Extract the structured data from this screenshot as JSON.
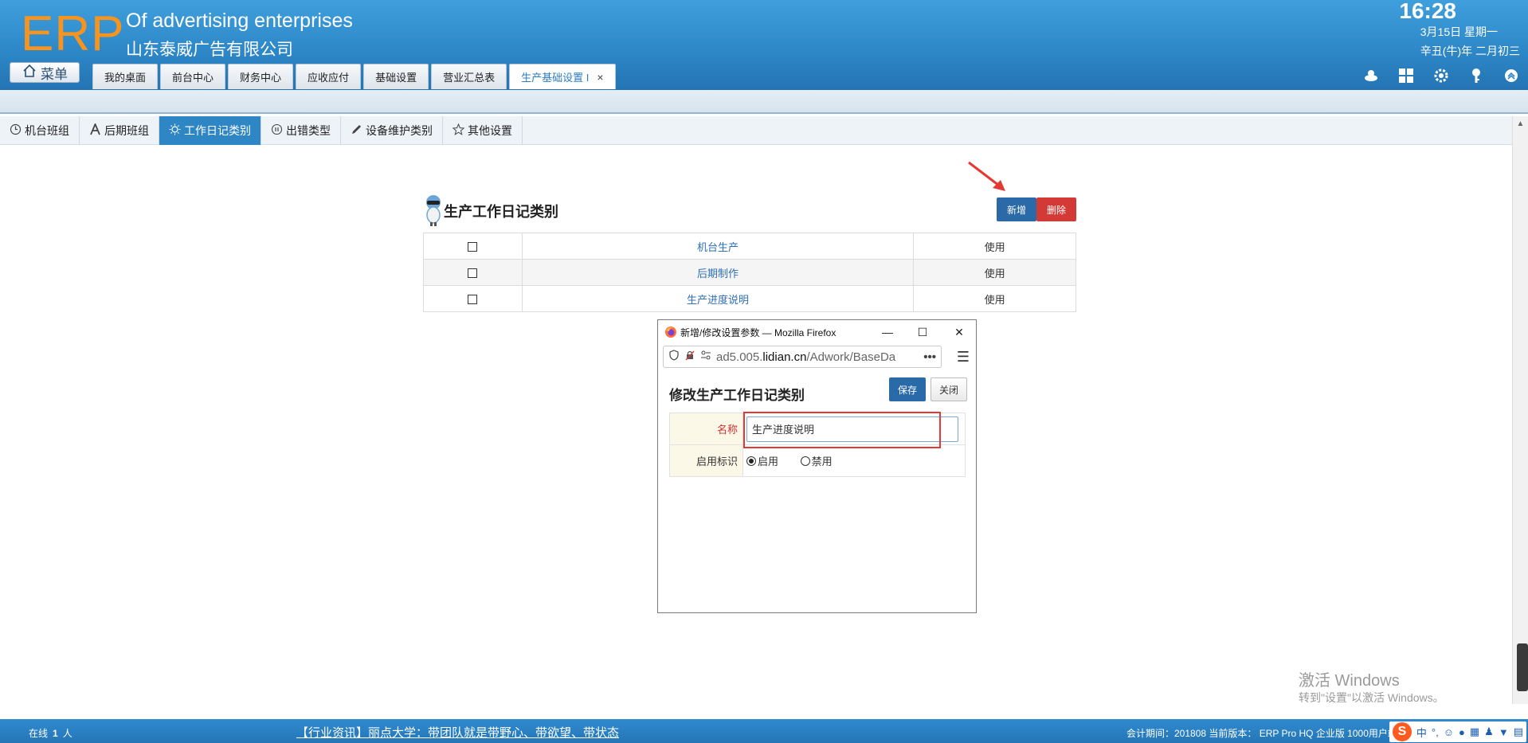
{
  "header": {
    "logo": "ERP",
    "company_en": "Of advertising enterprises",
    "company_cn": "山东泰威广告有限公司",
    "time": "16:28",
    "date": "3月15日 星期一",
    "lunar": "辛丑(牛)年 二月初三",
    "menu_label": "菜单"
  },
  "top_tabs": [
    {
      "label": "我的桌面"
    },
    {
      "label": "前台中心"
    },
    {
      "label": "财务中心"
    },
    {
      "label": "应收应付"
    },
    {
      "label": "基础设置"
    },
    {
      "label": "营业汇总表"
    },
    {
      "label": "生产基础设置 I",
      "close": "×"
    }
  ],
  "header_icons": [
    "user-cloud-icon",
    "apps-grid-icon",
    "gear-icon",
    "key-icon",
    "collapse-up-icon"
  ],
  "sec_tabs": [
    {
      "label": "机台班组",
      "icon": "clock-icon"
    },
    {
      "label": "后期班组",
      "icon": "font-a-icon"
    },
    {
      "label": "工作日记类别",
      "icon": "sun-icon"
    },
    {
      "label": "出错类型",
      "icon": "pause-circle-icon"
    },
    {
      "label": "设备维护类别",
      "icon": "pencil-icon"
    },
    {
      "label": "其他设置",
      "icon": "star-icon"
    }
  ],
  "panel": {
    "title": "生产工作日记类别",
    "add_label": "新增",
    "delete_label": "删除",
    "rows": [
      {
        "name": "机台生产",
        "status": "使用"
      },
      {
        "name": "后期制作",
        "status": "使用"
      },
      {
        "name": "生产进度说明",
        "status": "使用"
      }
    ]
  },
  "popup": {
    "window_title": "新增/修改设置参数 — Mozilla Firefox",
    "url_prefix": "ad5.005.",
    "url_host": "lidian.cn",
    "url_path": "/Adwork/BaseDa",
    "url_more": "•••",
    "form_title": "修改生产工作日记类别",
    "save_label": "保存",
    "close_label": "关闭",
    "name_label": "名称",
    "name_value": "生产进度说明",
    "flag_label": "启用标识",
    "enable_label": "启用",
    "disable_label": "禁用"
  },
  "watermark": {
    "line1": "激活 Windows",
    "line2": "转到\"设置\"以激活 Windows。"
  },
  "footer": {
    "online_prefix": "在线",
    "online_count": "1",
    "online_suffix": "人",
    "news": "【行业资讯】丽点大学：带团队就是带野心、带欲望、带状态",
    "info": "会计期间：201808 当前版本： ERP Pro HQ 企业版 1000用户端",
    "ime_lang": "中",
    "ime_punct": "°,"
  },
  "colors": {
    "header_blue": "#2d86c6",
    "logo_orange": "#f7941d",
    "active_tab_blue": "#2f86c4",
    "add_button": "#2a6aa8",
    "delete_button": "#d33a36",
    "highlight_red": "#e53935"
  }
}
